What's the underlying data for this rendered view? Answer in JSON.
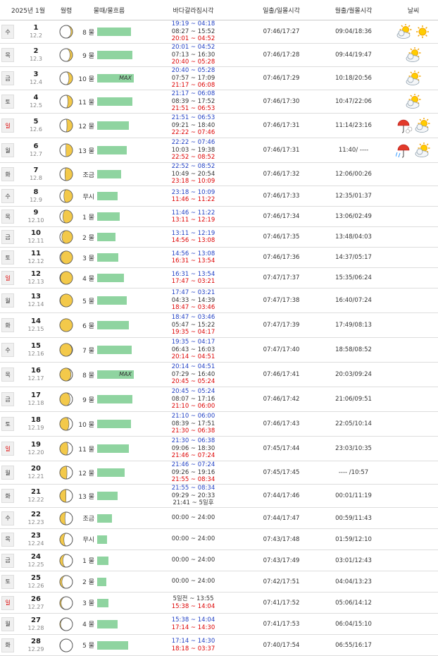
{
  "header": {
    "date_label": "2025년 1월",
    "moon_label": "월령",
    "tide_label": "물때/물흐름",
    "sea_label": "바다갈라짐시각",
    "sun_label": "일출/일몰시각",
    "moonrs_label": "월출/월몰시각",
    "weather_label": "날씨"
  },
  "days": [
    {
      "dow": "수",
      "red": false,
      "day": "1",
      "lunar": "12.2",
      "phase": 0.06,
      "tide": "8 물",
      "tide_level": 0.82,
      "max": "",
      "sea": [
        [
          "19:19 ~ 04:18",
          "b"
        ],
        [
          "08:27 ~ 15:52",
          ""
        ],
        [
          "20:01 ~ 04:52",
          "r"
        ]
      ],
      "sun": "07:46/17:27",
      "moon": "09:04/18:36",
      "wx": [
        "cloud-sun",
        "sun"
      ]
    },
    {
      "dow": "목",
      "red": false,
      "day": "2",
      "lunar": "12.3",
      "phase": 0.1,
      "tide": "9 물",
      "tide_level": 0.86,
      "max": "",
      "sea": [
        [
          "20:01 ~ 04:52",
          "b"
        ],
        [
          "07:13 ~ 16:30",
          ""
        ],
        [
          "20:40 ~ 05:28",
          "r"
        ]
      ],
      "sun": "07:46/17:28",
      "moon": "09:44/19:47",
      "wx": [
        "cloud-sun"
      ]
    },
    {
      "dow": "금",
      "red": false,
      "day": "3",
      "lunar": "12.4",
      "phase": 0.14,
      "tide": "10 물",
      "tide_level": 0.9,
      "max": "MAX",
      "sea": [
        [
          "20:40 ~ 05:28",
          "b"
        ],
        [
          "07:57 ~ 17:09",
          ""
        ],
        [
          "21:17 ~ 06:08",
          "r"
        ]
      ],
      "sun": "07:46/17:29",
      "moon": "10:18/20:56",
      "wx": [
        "cloud-sun"
      ]
    },
    {
      "dow": "토",
      "red": false,
      "day": "4",
      "lunar": "12.5",
      "phase": 0.18,
      "tide": "11 물",
      "tide_level": 0.86,
      "max": "",
      "sea": [
        [
          "21:17 ~ 06:08",
          "b"
        ],
        [
          "08:39 ~ 17:52",
          ""
        ],
        [
          "21:51 ~ 06:53",
          "r"
        ]
      ],
      "sun": "07:46/17:30",
      "moon": "10:47/22:06",
      "wx": [
        "cloud-sun"
      ]
    },
    {
      "dow": "일",
      "red": true,
      "day": "5",
      "lunar": "12.6",
      "phase": 0.22,
      "tide": "12 물",
      "tide_level": 0.78,
      "max": "",
      "sea": [
        [
          "21:51 ~ 06:53",
          "b"
        ],
        [
          "09:21 ~ 18:40",
          ""
        ],
        [
          "22:22 ~ 07:46",
          "r"
        ]
      ],
      "sun": "07:46/17:31",
      "moon": "11:14/23:16",
      "wx": [
        "umbrella-snow",
        "cloud-sun"
      ]
    },
    {
      "dow": "월",
      "red": false,
      "day": "6",
      "lunar": "12.7",
      "phase": 0.26,
      "tide": "13 물",
      "tide_level": 0.72,
      "max": "",
      "sea": [
        [
          "22:22 ~ 07:46",
          "b"
        ],
        [
          "10:03 ~ 19:38",
          ""
        ],
        [
          "22:52 ~ 08:52",
          "r"
        ]
      ],
      "sun": "07:46/17:31",
      "moon": "11:40/ ----",
      "wx": [
        "umbrella-rain",
        "cloud-sun"
      ]
    },
    {
      "dow": "화",
      "red": false,
      "day": "7",
      "lunar": "12.8",
      "phase": 0.3,
      "tide": "조금",
      "tide_level": 0.58,
      "max": "",
      "sea": [
        [
          "22:52 ~ 08:52",
          "b"
        ],
        [
          "10:49 ~ 20:54",
          ""
        ],
        [
          "23:18 ~ 10:09",
          "r"
        ]
      ],
      "sun": "07:46/17:32",
      "moon": "12:06/00:26",
      "wx": []
    },
    {
      "dow": "수",
      "red": false,
      "day": "8",
      "lunar": "12.9",
      "phase": 0.34,
      "tide": "무시",
      "tide_level": 0.5,
      "max": "",
      "sea": [
        [
          "23:18 ~ 10:09",
          "b"
        ],
        [
          "11:46 ~ 11:22",
          "r"
        ]
      ],
      "sun": "07:46/17:33",
      "moon": "12:35/01:37",
      "wx": []
    },
    {
      "dow": "목",
      "red": false,
      "day": "9",
      "lunar": "12.10",
      "phase": 0.38,
      "tide": "1 물",
      "tide_level": 0.56,
      "max": "",
      "sea": [
        [
          "11:46 ~ 11:22",
          "b"
        ],
        [
          "13:11 ~ 12:19",
          "r"
        ]
      ],
      "sun": "07:46/17:34",
      "moon": "13:06/02:49",
      "wx": []
    },
    {
      "dow": "금",
      "red": false,
      "day": "10",
      "lunar": "12.11",
      "phase": 0.42,
      "tide": "2 물",
      "tide_level": 0.44,
      "max": "",
      "sea": [
        [
          "13:11 ~ 12:19",
          "b"
        ],
        [
          "14:56 ~ 13:08",
          "r"
        ]
      ],
      "sun": "07:46/17:35",
      "moon": "13:48/04:03",
      "wx": []
    },
    {
      "dow": "토",
      "red": false,
      "day": "11",
      "lunar": "12.12",
      "phase": 0.46,
      "tide": "3 물",
      "tide_level": 0.52,
      "max": "",
      "sea": [
        [
          "14:56 ~ 13:08",
          "b"
        ],
        [
          "16:31 ~ 13:54",
          "r"
        ]
      ],
      "sun": "07:46/17:36",
      "moon": "14:37/05:17",
      "wx": []
    },
    {
      "dow": "일",
      "red": true,
      "day": "12",
      "lunar": "12.13",
      "phase": 0.48,
      "tide": "4 물",
      "tide_level": 0.66,
      "max": "",
      "sea": [
        [
          "16:31 ~ 13:54",
          "b"
        ],
        [
          "17:47 ~ 03:21",
          "r"
        ]
      ],
      "sun": "07:47/17:37",
      "moon": "15:35/06:24",
      "wx": []
    },
    {
      "dow": "월",
      "red": false,
      "day": "13",
      "lunar": "12.14",
      "phase": 0.49,
      "tide": "5 물",
      "tide_level": 0.72,
      "max": "",
      "sea": [
        [
          "17:47 ~ 03:21",
          "b"
        ],
        [
          "04:33 ~ 14:39",
          ""
        ],
        [
          "18:47 ~ 03:46",
          "r"
        ]
      ],
      "sun": "07:47/17:38",
      "moon": "16:40/07:24",
      "wx": []
    },
    {
      "dow": "화",
      "red": false,
      "day": "14",
      "lunar": "12.15",
      "phase": 0.5,
      "tide": "6 물",
      "tide_level": 0.78,
      "max": "",
      "sea": [
        [
          "18:47 ~ 03:46",
          "b"
        ],
        [
          "05:47 ~ 15:22",
          ""
        ],
        [
          "19:35 ~ 04:17",
          "r"
        ]
      ],
      "sun": "07:47/17:39",
      "moon": "17:49/08:13",
      "wx": []
    },
    {
      "dow": "수",
      "red": false,
      "day": "15",
      "lunar": "12.16",
      "phase": 0.52,
      "tide": "7 물",
      "tide_level": 0.84,
      "max": "",
      "sea": [
        [
          "19:35 ~ 04:17",
          "b"
        ],
        [
          "06:43 ~ 16:03",
          ""
        ],
        [
          "20:14 ~ 04:51",
          "r"
        ]
      ],
      "sun": "07:47/17:40",
      "moon": "18:58/08:52",
      "wx": []
    },
    {
      "dow": "목",
      "red": false,
      "day": "16",
      "lunar": "12.17",
      "phase": 0.56,
      "tide": "8 물",
      "tide_level": 0.9,
      "max": "MAX",
      "sea": [
        [
          "20:14 ~ 04:51",
          "b"
        ],
        [
          "07:29 ~ 16:40",
          ""
        ],
        [
          "20:45 ~ 05:24",
          "r"
        ]
      ],
      "sun": "07:46/17:41",
      "moon": "20:03/09:24",
      "wx": []
    },
    {
      "dow": "금",
      "red": false,
      "day": "17",
      "lunar": "12.18",
      "phase": 0.6,
      "tide": "9 물",
      "tide_level": 0.86,
      "max": "",
      "sea": [
        [
          "20:45 ~ 05:24",
          "b"
        ],
        [
          "08:07 ~ 17:16",
          ""
        ],
        [
          "21:10 ~ 06:00",
          "r"
        ]
      ],
      "sun": "07:46/17:42",
      "moon": "21:06/09:51",
      "wx": []
    },
    {
      "dow": "토",
      "red": false,
      "day": "18",
      "lunar": "12.19",
      "phase": 0.64,
      "tide": "10 물",
      "tide_level": 0.82,
      "max": "",
      "sea": [
        [
          "21:10 ~ 06:00",
          "b"
        ],
        [
          "08:39 ~ 17:51",
          ""
        ],
        [
          "21:30 ~ 06:38",
          "r"
        ]
      ],
      "sun": "07:46/17:43",
      "moon": "22:05/10:14",
      "wx": []
    },
    {
      "dow": "일",
      "red": true,
      "day": "19",
      "lunar": "12.20",
      "phase": 0.68,
      "tide": "11 물",
      "tide_level": 0.78,
      "max": "",
      "sea": [
        [
          "21:30 ~ 06:38",
          "b"
        ],
        [
          "09:06 ~ 18:30",
          ""
        ],
        [
          "21:46 ~ 07:24",
          "r"
        ]
      ],
      "sun": "07:45/17:44",
      "moon": "23:03/10:35",
      "wx": []
    },
    {
      "dow": "월",
      "red": false,
      "day": "20",
      "lunar": "12.21",
      "phase": 0.72,
      "tide": "12 물",
      "tide_level": 0.68,
      "max": "",
      "sea": [
        [
          "21:46 ~ 07:24",
          "b"
        ],
        [
          "09:26 ~ 19:16",
          ""
        ],
        [
          "21:55 ~ 08:34",
          "r"
        ]
      ],
      "sun": "07:45/17:45",
      "moon": "---- /10:57",
      "wx": []
    },
    {
      "dow": "화",
      "red": false,
      "day": "21",
      "lunar": "12.22",
      "phase": 0.76,
      "tide": "13 물",
      "tide_level": 0.5,
      "max": "",
      "sea": [
        [
          "21:55 ~ 08:34",
          "b"
        ],
        [
          "09:29 ~ 20:33",
          ""
        ],
        [
          "21:41 ~ 5일후",
          ""
        ]
      ],
      "sun": "07:44/17:46",
      "moon": "00:01/11:19",
      "wx": []
    },
    {
      "dow": "수",
      "red": false,
      "day": "22",
      "lunar": "12.23",
      "phase": 0.8,
      "tide": "조금",
      "tide_level": 0.36,
      "max": "",
      "sea": [
        [
          "00:00 ~ 24:00",
          ""
        ]
      ],
      "sun": "07:44/17:47",
      "moon": "00:59/11:43",
      "wx": []
    },
    {
      "dow": "목",
      "red": false,
      "day": "23",
      "lunar": "12.24",
      "phase": 0.84,
      "tide": "무시",
      "tide_level": 0.24,
      "max": "",
      "sea": [
        [
          "00:00 ~ 24:00",
          ""
        ]
      ],
      "sun": "07:43/17:48",
      "moon": "01:59/12:10",
      "wx": []
    },
    {
      "dow": "금",
      "red": false,
      "day": "24",
      "lunar": "12.25",
      "phase": 0.88,
      "tide": "1 물",
      "tide_level": 0.28,
      "max": "",
      "sea": [
        [
          "00:00 ~ 24:00",
          ""
        ]
      ],
      "sun": "07:43/17:49",
      "moon": "03:01/12:43",
      "wx": []
    },
    {
      "dow": "토",
      "red": false,
      "day": "25",
      "lunar": "12.26",
      "phase": 0.92,
      "tide": "2 물",
      "tide_level": 0.22,
      "max": "",
      "sea": [
        [
          "00:00 ~ 24:00",
          ""
        ]
      ],
      "sun": "07:42/17:51",
      "moon": "04:04/13:23",
      "wx": []
    },
    {
      "dow": "일",
      "red": true,
      "day": "26",
      "lunar": "12.27",
      "phase": 0.95,
      "tide": "3 물",
      "tide_level": 0.28,
      "max": "",
      "sea": [
        [
          "5일전 ~ 13:55",
          ""
        ],
        [
          "15:38 ~ 14:04",
          "r"
        ]
      ],
      "sun": "07:41/17:52",
      "moon": "05:06/14:12",
      "wx": []
    },
    {
      "dow": "월",
      "red": false,
      "day": "27",
      "lunar": "12.28",
      "phase": 0.97,
      "tide": "4 물",
      "tide_level": 0.5,
      "max": "",
      "sea": [
        [
          "15:38 ~ 14:04",
          "b"
        ],
        [
          "17:14 ~ 14:30",
          "r"
        ]
      ],
      "sun": "07:41/17:53",
      "moon": "06:04/15:10",
      "wx": []
    },
    {
      "dow": "화",
      "red": false,
      "day": "28",
      "lunar": "12.29",
      "phase": 0.99,
      "tide": "5 물",
      "tide_level": 0.76,
      "max": "",
      "sea": [
        [
          "17:14 ~ 14:30",
          "b"
        ],
        [
          "18:18 ~ 03:37",
          "r"
        ]
      ],
      "sun": "07:40/17:54",
      "moon": "06:55/16:17",
      "wx": []
    }
  ]
}
